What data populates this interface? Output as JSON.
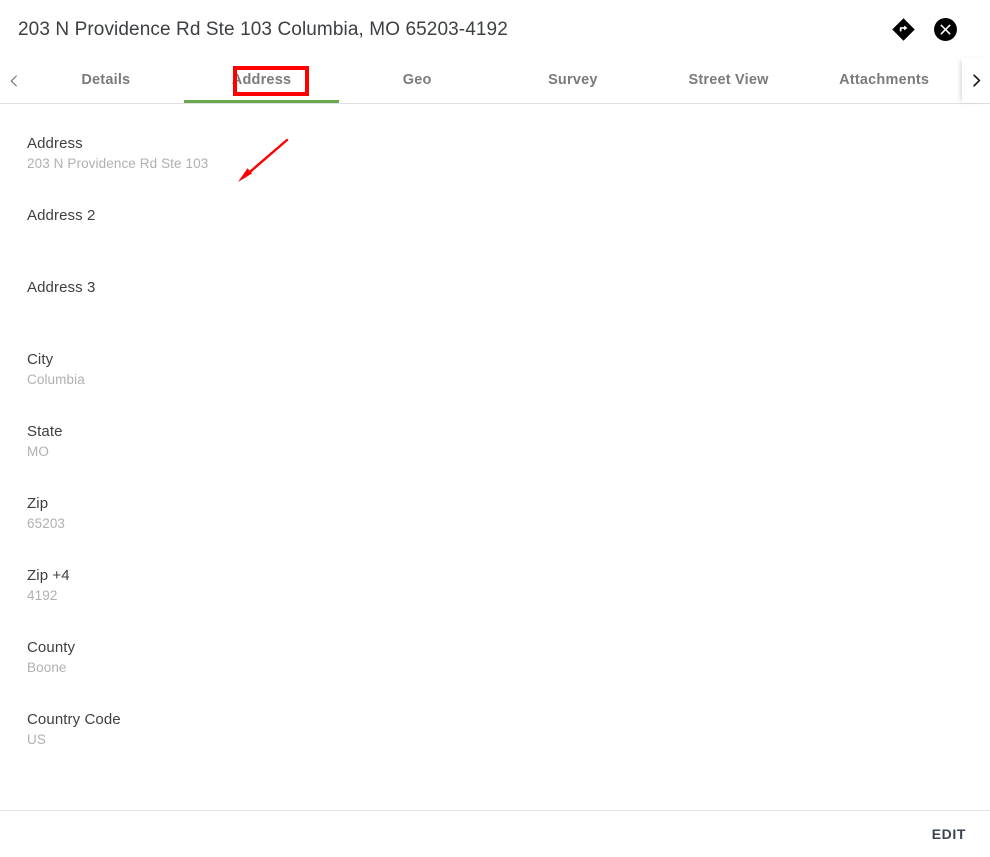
{
  "header": {
    "title": "203 N Providence Rd Ste 103 Columbia, MO 65203-4192",
    "directions_icon": "directions-diamond-icon",
    "close_icon": "close-circle-icon"
  },
  "tabbar": {
    "scroll_left_icon": "chevron-left-icon",
    "scroll_right_icon": "chevron-right-icon",
    "active_tab": "Address",
    "accent_color": "#6aa84f",
    "tabs": [
      {
        "label": "Details"
      },
      {
        "label": "Address"
      },
      {
        "label": "Geo"
      },
      {
        "label": "Survey"
      },
      {
        "label": "Street View"
      },
      {
        "label": "Attachments"
      }
    ]
  },
  "annotations": {
    "box_color": "#fe0000",
    "arrow_color": "#fe0000",
    "box_target": "Address",
    "arrow_target": "Address field value"
  },
  "form": {
    "fields": [
      {
        "label": "Address",
        "value": "203 N Providence Rd Ste 103"
      },
      {
        "label": "Address 2",
        "value": ""
      },
      {
        "label": "Address 3",
        "value": ""
      },
      {
        "label": "City",
        "value": "Columbia"
      },
      {
        "label": "State",
        "value": "MO"
      },
      {
        "label": "Zip",
        "value": "65203"
      },
      {
        "label": "Zip +4",
        "value": "4192"
      },
      {
        "label": "County",
        "value": "Boone"
      },
      {
        "label": "Country Code",
        "value": "US"
      }
    ]
  },
  "footer": {
    "edit_label": "EDIT"
  }
}
